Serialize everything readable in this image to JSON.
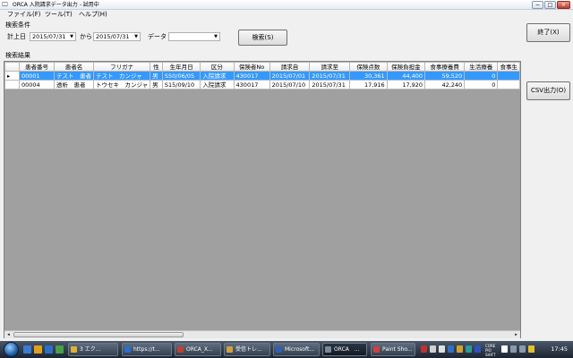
{
  "window": {
    "title": "ORCA  入院請求データ出力 - 試用中",
    "controls": [
      "−",
      "□",
      "×"
    ]
  },
  "menu": [
    "ファイル(F)",
    "ツール(T)",
    "ヘルプ(H)"
  ],
  "search": {
    "section_label": "検索条件",
    "date_label": "計上日",
    "date_from": "2015/07/31",
    "range_word": "から",
    "date_to": "2015/07/31",
    "data_label": "データ",
    "data_value": "",
    "search_button": "検索(S)"
  },
  "results": {
    "section_label": "検索結果",
    "columns": [
      "",
      "患者番号",
      "患者名",
      "フリガナ",
      "性",
      "生年月日",
      "区分",
      "保険者No",
      "請求自",
      "請求至",
      "保険点数",
      "保険負担金",
      "食事療養費",
      "生活療養",
      "食事生"
    ],
    "rows": [
      [
        "▸",
        "00001",
        "テスト　患者",
        "テスト　カンジャ",
        "男",
        "S50/06/05",
        "入院請求",
        "430017",
        "2015/07/01",
        "2015/07/31",
        "30,361",
        "44,400",
        "59,520",
        "0",
        ""
      ],
      [
        "",
        "00004",
        "透析　患者",
        "トウセキ　カンジャ",
        "男",
        "S15/09/10",
        "入院請求",
        "430017",
        "2015/07/10",
        "2015/07/31",
        "17,916",
        "17,920",
        "42,240",
        "0",
        ""
      ]
    ],
    "scroll_arrows": [
      "◂",
      "▸"
    ]
  },
  "side_buttons": {
    "exit": "終了(X)",
    "csv": "CSV出力(O)"
  },
  "taskbar": {
    "buttons": [
      "3 エク...",
      "https://t...",
      "ORCA_X...",
      "受信トレ...",
      "Microsoft...",
      "ORCA　...",
      "Paint Sho..."
    ],
    "tray_text": [
      "CORE",
      "PIO",
      "SHIFT"
    ],
    "clock": "17:45"
  }
}
